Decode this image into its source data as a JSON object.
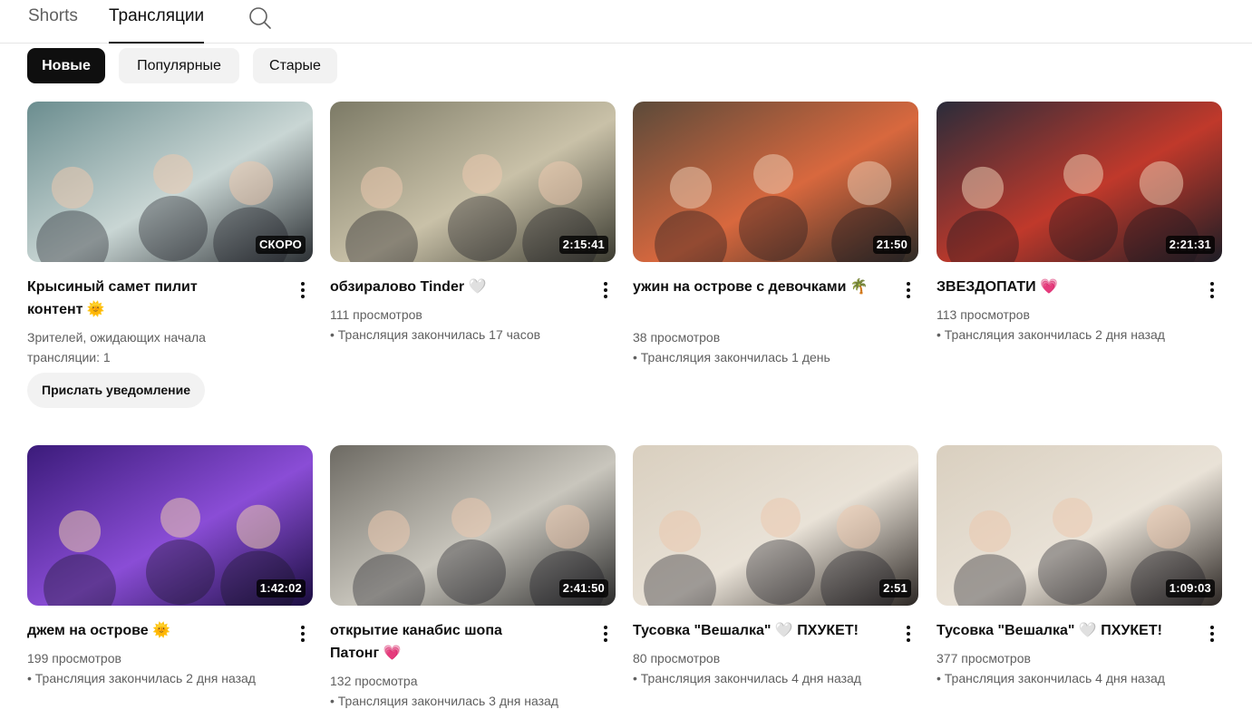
{
  "tabs": [
    {
      "label": "Shorts"
    },
    {
      "label": "Трансляции"
    }
  ],
  "chips": [
    {
      "label": "Новые"
    },
    {
      "label": "Популярные"
    },
    {
      "label": "Старые"
    }
  ],
  "videos": [
    {
      "emoji": "💗",
      "title": "Крысиный самет пилит контент 🌞",
      "badge": "СКОРО",
      "meta1": "Зрителей, ожидающих начала трансляции: 1",
      "button": "Прислать уведомление"
    },
    {
      "emoji": "😈",
      "title": "обзиралово Tinder 🤍",
      "badge": "2:15:41",
      "meta1": "111 просмотров",
      "meta2": "• Трансляция закончилась 17 часов"
    },
    {
      "emoji": "🤍",
      "title": "ужин на острове с девочками 🌴",
      "badge": "21:50",
      "meta1": "38 просмотров",
      "meta2": "• Трансляция закончилась 1 день"
    },
    {
      "emoji": "🌴",
      "title": "ЗВЕЗДОПАТИ 💗",
      "badge": "2:21:31",
      "meta1": "113 просмотров",
      "meta2": "• Трансляция закончилась 2 дня назад"
    },
    {
      "emoji": "🤍",
      "title": "джем на острове 🌞",
      "badge": "1:42:02",
      "meta1": "199 просмотров",
      "meta2": "• Трансляция закончилась 2 дня назад"
    },
    {
      "emoji": "🌴",
      "title": "открытие канабис шопа Патонг 💗",
      "badge": "2:41:50",
      "meta1": "132 просмотра",
      "meta2": "• Трансляция закончилась 3 дня назад"
    },
    {
      "emoji": "🌴",
      "title": "Тусовка \"Вешалка\" 🤍 ПХУКЕТ!",
      "badge": "2:51",
      "meta1": "80 просмотров",
      "meta2": "• Трансляция закончилась 4 дня назад"
    },
    {
      "emoji": "🌴",
      "title": "Тусовка \"Вешалка\" 🤍 ПХУКЕТ!",
      "badge": "1:09:03",
      "meta1": "377 просмотров",
      "meta2": "• Трансляция закончилась 4 дня назад"
    }
  ],
  "thumb_colors": [
    [
      "#6b8d8f",
      "#c9d6d4",
      "#2b2f33"
    ],
    [
      "#7c7a66",
      "#c9c1a8",
      "#3a3a30"
    ],
    [
      "#5b4a3a",
      "#d8683e",
      "#2c2a26"
    ],
    [
      "#2a2c3a",
      "#c0392b",
      "#1c1d25"
    ],
    [
      "#3b1b7a",
      "#8a4dd6",
      "#1a0d3f"
    ],
    [
      "#6d6a63",
      "#c9c6bd",
      "#2a2a2a"
    ],
    [
      "#d9cfbf",
      "#e9e2d7",
      "#2b2623"
    ],
    [
      "#d9cfbf",
      "#e9e2d7",
      "#2b2623"
    ]
  ]
}
